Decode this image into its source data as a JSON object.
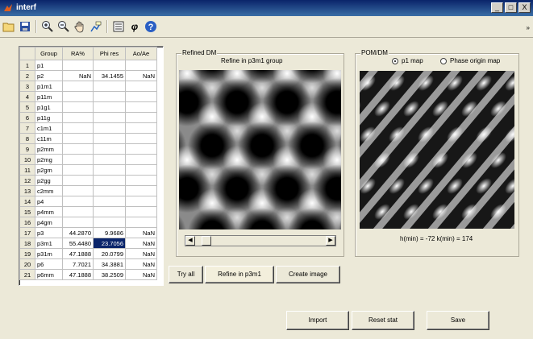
{
  "window": {
    "title": "interf",
    "min_label": "_",
    "max_label": "□",
    "close_label": "X"
  },
  "toolbar": {
    "icons": [
      "open-folder-icon",
      "save-icon",
      "zoom-in-icon",
      "zoom-out-icon",
      "pan-hand-icon",
      "data-cursor-icon",
      "list-icon",
      "phi-icon",
      "help-icon"
    ],
    "phi_glyph": "φ",
    "help_glyph": "?",
    "overflow_glyph": "»"
  },
  "table": {
    "headers": [
      "",
      "Group",
      "RA%",
      "Phi res",
      "Ao/Ae"
    ],
    "rows": [
      [
        "1",
        "p1",
        "",
        "",
        ""
      ],
      [
        "2",
        "p2",
        "NaN",
        "34.1455",
        "NaN"
      ],
      [
        "3",
        "p1m1",
        "",
        "",
        ""
      ],
      [
        "4",
        "p11m",
        "",
        "",
        ""
      ],
      [
        "5",
        "p1g1",
        "",
        "",
        ""
      ],
      [
        "6",
        "p11g",
        "",
        "",
        ""
      ],
      [
        "7",
        "c1m1",
        "",
        "",
        ""
      ],
      [
        "8",
        "c11m",
        "",
        "",
        ""
      ],
      [
        "9",
        "p2mm",
        "",
        "",
        ""
      ],
      [
        "10",
        "p2mg",
        "",
        "",
        ""
      ],
      [
        "11",
        "p2gm",
        "",
        "",
        ""
      ],
      [
        "12",
        "p2gg",
        "",
        "",
        ""
      ],
      [
        "13",
        "c2mm",
        "",
        "",
        ""
      ],
      [
        "14",
        "p4",
        "",
        "",
        ""
      ],
      [
        "15",
        "p4mm",
        "",
        "",
        ""
      ],
      [
        "16",
        "p4gm",
        "",
        "",
        ""
      ],
      [
        "17",
        "p3",
        "44.2870",
        "9.9686",
        "NaN"
      ],
      [
        "18",
        "p3m1",
        "55.4480",
        "23.7056",
        "NaN"
      ],
      [
        "19",
        "p31m",
        "47.1888",
        "20.0799",
        "NaN"
      ],
      [
        "20",
        "p6",
        "7.7021",
        "34.3881",
        "NaN"
      ],
      [
        "21",
        "p6mm",
        "47.1888",
        "38.2509",
        "NaN"
      ]
    ],
    "selected_row": 17
  },
  "refined": {
    "panel_title": "Refined DM",
    "subtitle": "Refine in p3m1 group",
    "scroll_position": 0.1
  },
  "pom": {
    "panel_title": "POM/DM",
    "radio_p1": "p1 map",
    "radio_phase": "Phase origin map",
    "selected": "p1 map",
    "caption": "h(min) = -72 k(min) = 174"
  },
  "buttons": {
    "try_all": "Try all",
    "refine": "Refine in p3m1",
    "create_image": "Create image",
    "import": "Import",
    "reset_stat": "Reset stat",
    "save": "Save"
  },
  "colors": {
    "titlebar": "#0a246a",
    "selection": "#0a246a",
    "face": "#ece9d8"
  }
}
